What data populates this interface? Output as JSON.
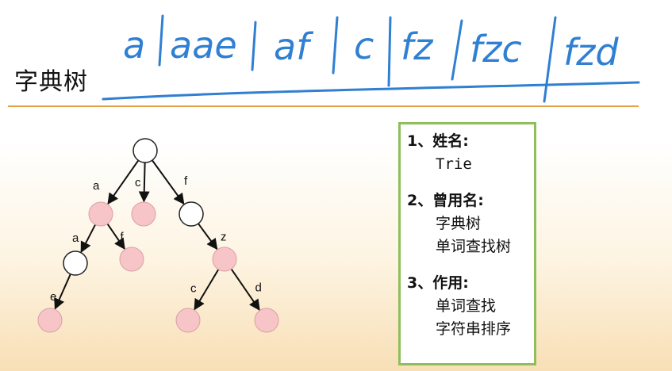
{
  "page": {
    "title": "字典树"
  },
  "handwriting": {
    "words": [
      "a",
      "aae",
      "af",
      "c",
      "fz",
      "fzc",
      "fzd"
    ],
    "color": "#2f7fd2"
  },
  "colors": {
    "accent_rule": "#e6a246",
    "box_border": "#8fbe5c",
    "node_pink": "#f7c5c8",
    "node_white": "#ffffff"
  },
  "tree": {
    "nodes": [
      {
        "id": "root",
        "fill": "white"
      },
      {
        "id": "a",
        "fill": "pink"
      },
      {
        "id": "c",
        "fill": "pink"
      },
      {
        "id": "f",
        "fill": "white"
      },
      {
        "id": "aa",
        "fill": "white"
      },
      {
        "id": "af",
        "fill": "pink"
      },
      {
        "id": "fz",
        "fill": "pink"
      },
      {
        "id": "aae",
        "fill": "pink"
      },
      {
        "id": "fzc",
        "fill": "pink"
      },
      {
        "id": "fzd",
        "fill": "pink"
      }
    ],
    "edges": [
      {
        "from": "root",
        "to": "a",
        "label": "a"
      },
      {
        "from": "root",
        "to": "c",
        "label": "c"
      },
      {
        "from": "root",
        "to": "f",
        "label": "f"
      },
      {
        "from": "a",
        "to": "aa",
        "label": "a"
      },
      {
        "from": "a",
        "to": "af",
        "label": "f"
      },
      {
        "from": "aa",
        "to": "aae",
        "label": "e"
      },
      {
        "from": "f",
        "to": "fz",
        "label": "z"
      },
      {
        "from": "fz",
        "to": "fzc",
        "label": "c"
      },
      {
        "from": "fz",
        "to": "fzd",
        "label": "d"
      }
    ]
  },
  "info": {
    "sections": [
      {
        "heading": "1、姓名:",
        "items": [
          "Trie"
        ]
      },
      {
        "heading": "2、曾用名:",
        "items": [
          "字典树",
          "单词查找树"
        ]
      },
      {
        "heading": "3、作用:",
        "items": [
          "单词查找",
          "字符串排序"
        ]
      }
    ]
  }
}
